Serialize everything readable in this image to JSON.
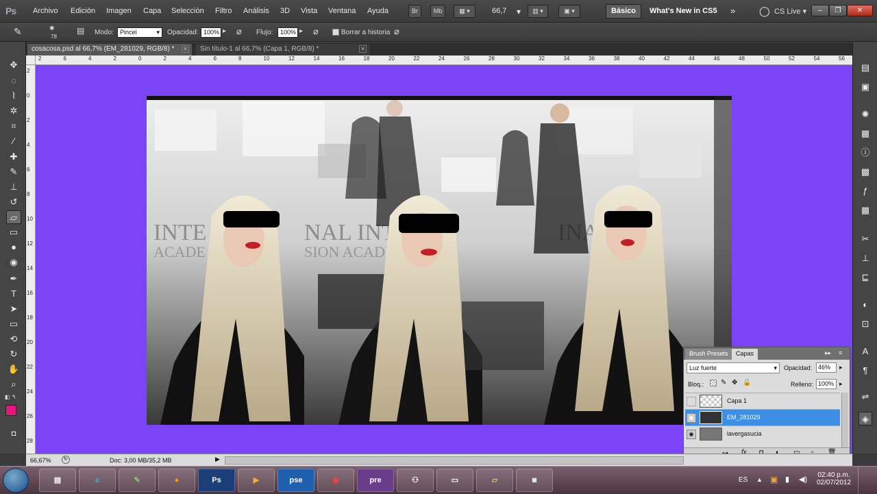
{
  "menubar": {
    "logo": "Ps",
    "items": [
      "Archivo",
      "Edición",
      "Imagen",
      "Capa",
      "Selección",
      "Filtro",
      "Análisis",
      "3D",
      "Vista",
      "Ventana",
      "Ayuda"
    ],
    "bridge": "Br",
    "minibridge": "Mb",
    "zoom": "66,7",
    "workspace": "Básico",
    "whats_new": "What's New in CS5",
    "cs_live": "CS Live"
  },
  "options": {
    "brush_size": "78",
    "modo_label": "Modo:",
    "modo_value": "Pincel",
    "opacidad_label": "Opacidad:",
    "opacidad_value": "100%",
    "flujo_label": "Flujo:",
    "flujo_value": "100%",
    "borrar_label": "Borrar a historia"
  },
  "tabs": [
    {
      "title": "cosacosa.psd al 66,7% (EM_281029, RGB/8) *"
    },
    {
      "title": "Sin título-1 al 66,7% (Capa 1, RGB/8) *"
    }
  ],
  "ruler_h": [
    "2",
    "6",
    "4",
    "2",
    "0",
    "2",
    "4",
    "6",
    "8",
    "10",
    "12",
    "14",
    "16",
    "18",
    "20",
    "22",
    "24",
    "26",
    "28",
    "30",
    "32",
    "34",
    "36",
    "38",
    "40",
    "42",
    "44",
    "46",
    "48",
    "50",
    "52",
    "54",
    "56"
  ],
  "ruler_v": [
    "2",
    "0",
    "2",
    "4",
    "6",
    "8",
    "10",
    "12",
    "14",
    "16",
    "18",
    "20",
    "22",
    "24",
    "26",
    "28"
  ],
  "layers_panel": {
    "tab_brush": "Brush Presets",
    "tab_capas": "Capas",
    "blend_mode": "Luz fuerte",
    "opacity_label": "Opacidad:",
    "opacity_value": "46%",
    "lock_label": "Bloq.:",
    "fill_label": "Relleno:",
    "fill_value": "100%",
    "layers": [
      {
        "name": "Capa 1"
      },
      {
        "name": "EM_281029"
      },
      {
        "name": "lavergasucia"
      }
    ]
  },
  "status": {
    "zoom": "66,67%",
    "doc": "Doc: 3,00 MB/35,2 MB"
  },
  "taskbar": {
    "lang": "ES",
    "time": "02:40 p.m.",
    "date": "02/07/2012",
    "apps": [
      "Explorer",
      "IE",
      "Evernote",
      "Firefox",
      "Ps",
      "Media",
      "pse",
      "Chrome",
      "pre",
      "Network",
      "Window",
      "Notes",
      "Camera"
    ]
  },
  "colors": {
    "canvas_bg": "#7b44f7",
    "foreground": "#e8177f",
    "selected_layer": "#3d8fe6"
  }
}
